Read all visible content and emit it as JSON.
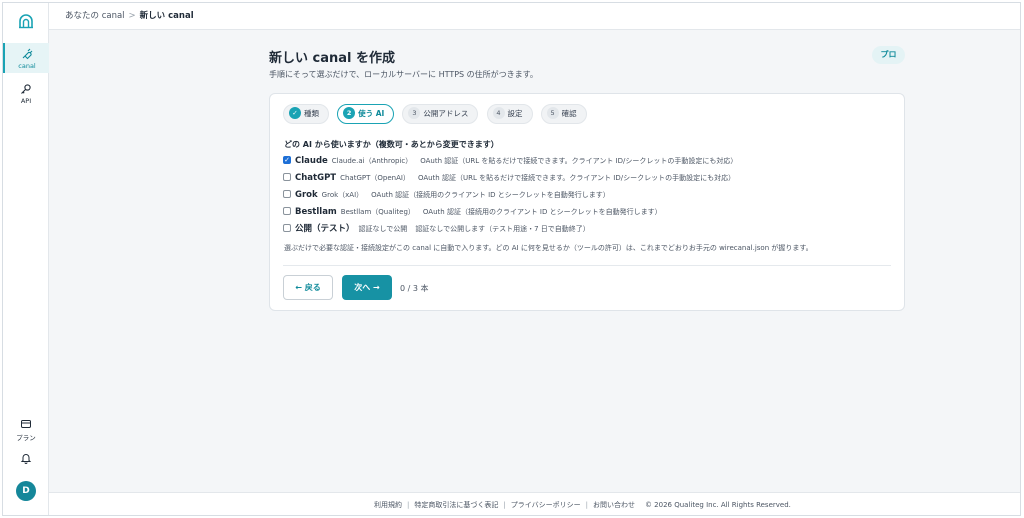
{
  "sidebar": {
    "logo_icon": "arch-logo-icon",
    "items": [
      {
        "label": "canal",
        "icon": "plug-icon",
        "active": true
      },
      {
        "label": "API",
        "icon": "key-icon",
        "active": false
      }
    ],
    "bottom_items": [
      {
        "label": "プラン",
        "icon": "card-icon"
      },
      {
        "label": "",
        "icon": "bell-icon"
      }
    ],
    "avatar_initial": "D"
  },
  "breadcrumb": {
    "parent": "あなたの canal",
    "separator": ">",
    "current": "新しい canal"
  },
  "header": {
    "title": "新しい canal を作成",
    "subtitle": "手順にそって選ぶだけで、ローカルサーバーに HTTPS の住所がつきます。",
    "badge": "プロ"
  },
  "steps": [
    {
      "num": "✓",
      "label": "種類",
      "state": "done"
    },
    {
      "num": "2",
      "label": "使う AI",
      "state": "current"
    },
    {
      "num": "3",
      "label": "公開アドレス",
      "state": "pending"
    },
    {
      "num": "4",
      "label": "設定",
      "state": "pending"
    },
    {
      "num": "5",
      "label": "確認",
      "state": "pending"
    }
  ],
  "question": "どの AI から使いますか（複数可・あとから変更できます）",
  "options": [
    {
      "name": "Claude",
      "provider": "Claude.ai（Anthropic）",
      "desc": "OAuth 認証（URL を貼るだけで接続できます。クライアント ID/シークレットの手動設定にも対応）",
      "checked": true
    },
    {
      "name": "ChatGPT",
      "provider": "ChatGPT（OpenAI）",
      "desc": "OAuth 認証（URL を貼るだけで接続できます。クライアント ID/シークレットの手動設定にも対応）",
      "checked": false
    },
    {
      "name": "Grok",
      "provider": "Grok（xAI）",
      "desc": "OAuth 認証（接続用のクライアント ID とシークレットを自動発行します）",
      "checked": false
    },
    {
      "name": "Bestllam",
      "provider": "Bestllam（Qualiteg）",
      "desc": "OAuth 認証（接続用のクライアント ID とシークレットを自動発行します）",
      "checked": false
    },
    {
      "name": "公開（テスト）",
      "provider": "認証なしで公開",
      "desc": "認証なしで公開します（テスト用途・7 日で自動終了）",
      "checked": false
    }
  ],
  "note": "選ぶだけで必要な認証・接続設定がこの canal に自動で入ります。どの AI に何を見せるか（ツールの許可）は、これまでどおりお手元の wirecanal.json が握ります。",
  "actions": {
    "back": "← 戻る",
    "next": "次へ →",
    "count": "0 / 3 本"
  },
  "footer": {
    "links": [
      "利用規約",
      "特定商取引法に基づく表記",
      "プライバシーポリシー",
      "お問い合わせ"
    ],
    "copyright": "© 2026 Qualiteg Inc. All Rights Reserved."
  },
  "colors": {
    "accent": "#1aa3b4",
    "primary_button": "#1792a4",
    "checkbox": "#1d6fd6"
  }
}
